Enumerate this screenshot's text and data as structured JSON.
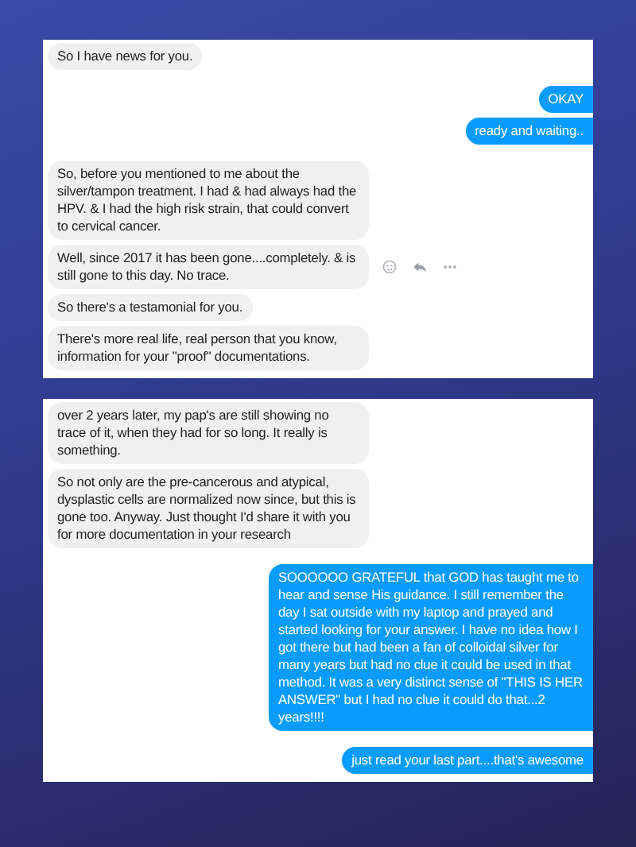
{
  "panels": [
    {
      "groups": [
        {
          "messages": [
            {
              "kind": "incoming",
              "text": "So I have news for you.",
              "hovered": false
            }
          ]
        },
        {
          "messages": [
            {
              "kind": "outgoing",
              "text": "OKAY",
              "hovered": false
            },
            {
              "kind": "outgoing",
              "text": "ready and waiting..",
              "hovered": false
            }
          ]
        },
        {
          "messages": [
            {
              "kind": "incoming",
              "text": "So, before you mentioned to me about the silver/tampon treatment. I had & had always had the HPV. & I had the high risk strain, that could convert to cervical cancer.",
              "hovered": false
            },
            {
              "kind": "incoming",
              "text": "Well, since 2017 it has been gone....completely. & is still gone to this day. No trace.",
              "hovered": true
            },
            {
              "kind": "incoming",
              "text": "So there's a testamonial for you.",
              "hovered": false
            },
            {
              "kind": "incoming",
              "text": "There's more real life, real person that you know, information for your \"proof\" documentations.",
              "hovered": false
            }
          ]
        }
      ]
    },
    {
      "groups": [
        {
          "messages": [
            {
              "kind": "incoming",
              "text": "over 2 years later, my pap's are still showing no trace of it, when they had for so long. It really is something.",
              "hovered": false
            },
            {
              "kind": "incoming",
              "text": "So not only are the pre-cancerous and atypical, dysplastic cells are normalized now since, but this is gone too. Anyway. Just thought I'd share it with you for more documentation in your research",
              "hovered": false
            }
          ]
        },
        {
          "messages": [
            {
              "kind": "outgoing",
              "text": "SOOOOOO GRATEFUL that GOD has taught me to hear and sense His guidance.  I still remember the day I sat outside with my laptop and prayed and started looking for your answer.  I have no idea how I got there but had been a fan of colloidal silver for many years but had no clue it could be used in that method.  It was a very distinct sense of \"THIS IS HER ANSWER\" but I had no clue it could do that...2 years!!!!",
              "hovered": false
            }
          ]
        },
        {
          "messages": [
            {
              "kind": "outgoing",
              "text": "just read your last part....that's awesome",
              "hovered": false
            }
          ]
        }
      ]
    }
  ]
}
